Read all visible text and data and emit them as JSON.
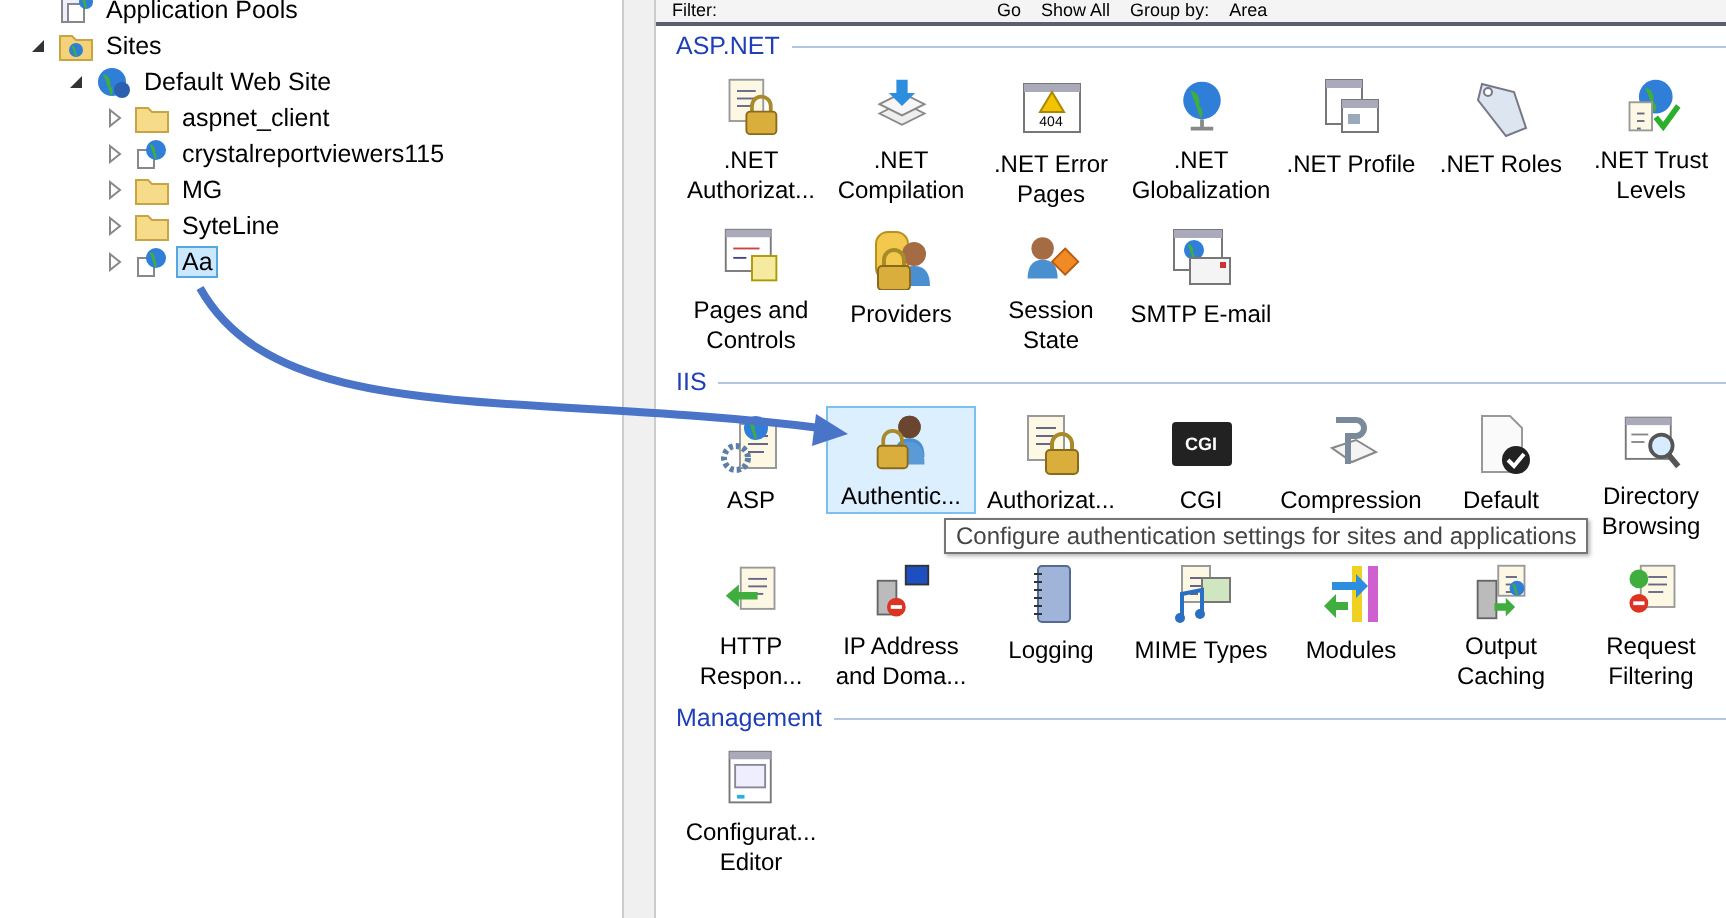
{
  "toolbar": {
    "filter_label": "Filter:",
    "go_button": "Go",
    "show_all_button": "Show All",
    "group_by_label": "Group by:",
    "group_by_value": "Area"
  },
  "tree": [
    {
      "label": "Application Pools",
      "kind": "pools",
      "selected": false
    },
    {
      "label": "Sites",
      "kind": "sites",
      "expanded": true,
      "selected": false,
      "children": [
        {
          "label": "Default Web Site",
          "kind": "site",
          "expanded": true,
          "selected": false,
          "children": [
            {
              "label": "aspnet_client",
              "kind": "folder",
              "expanded": false,
              "selected": false
            },
            {
              "label": "crystalreportviewers115",
              "kind": "application",
              "expanded": false,
              "selected": false
            },
            {
              "label": "MG",
              "kind": "folder",
              "expanded": false,
              "selected": false
            },
            {
              "label": "SyteLine",
              "kind": "folder",
              "expanded": false,
              "selected": false
            },
            {
              "label": "Aa",
              "kind": "application",
              "expanded": false,
              "selected": true
            }
          ]
        }
      ]
    }
  ],
  "sections": [
    {
      "title": "ASP.NET",
      "features": [
        {
          "label": ".NET Authorizat...",
          "selected": false
        },
        {
          "label": ".NET Compilation",
          "selected": false
        },
        {
          "label": ".NET Error Pages",
          "selected": false,
          "icon_text": "404"
        },
        {
          "label": ".NET Globalization",
          "selected": false
        },
        {
          "label": ".NET Profile",
          "selected": false
        },
        {
          "label": ".NET Roles",
          "selected": false
        },
        {
          "label": ".NET Trust Levels",
          "selected": false
        },
        {
          "label": "Pages and Controls",
          "selected": false
        },
        {
          "label": "Providers",
          "selected": false
        },
        {
          "label": "Session State",
          "selected": false
        },
        {
          "label": "SMTP E-mail",
          "selected": false
        }
      ]
    },
    {
      "title": "IIS",
      "features": [
        {
          "label": "ASP",
          "selected": false
        },
        {
          "label": "Authentic...",
          "selected": true
        },
        {
          "label": "Authorizat...",
          "selected": false
        },
        {
          "label": "CGI",
          "selected": false,
          "icon_text": "CGI"
        },
        {
          "label": "Compression",
          "selected": false
        },
        {
          "label": "Default",
          "selected": false
        },
        {
          "label": "Directory Browsing",
          "selected": false
        },
        {
          "label": "HTTP Respon...",
          "selected": false
        },
        {
          "label": "IP Address and Doma...",
          "selected": false
        },
        {
          "label": "Logging",
          "selected": false
        },
        {
          "label": "MIME Types",
          "selected": false
        },
        {
          "label": "Modules",
          "selected": false
        },
        {
          "label": "Output Caching",
          "selected": false
        },
        {
          "label": "Request Filtering",
          "selected": false
        }
      ],
      "tooltip": "Configure authentication settings for sites and applications"
    },
    {
      "title": "Management",
      "features": [
        {
          "label": "Configurat... Editor",
          "selected": false
        }
      ]
    }
  ]
}
